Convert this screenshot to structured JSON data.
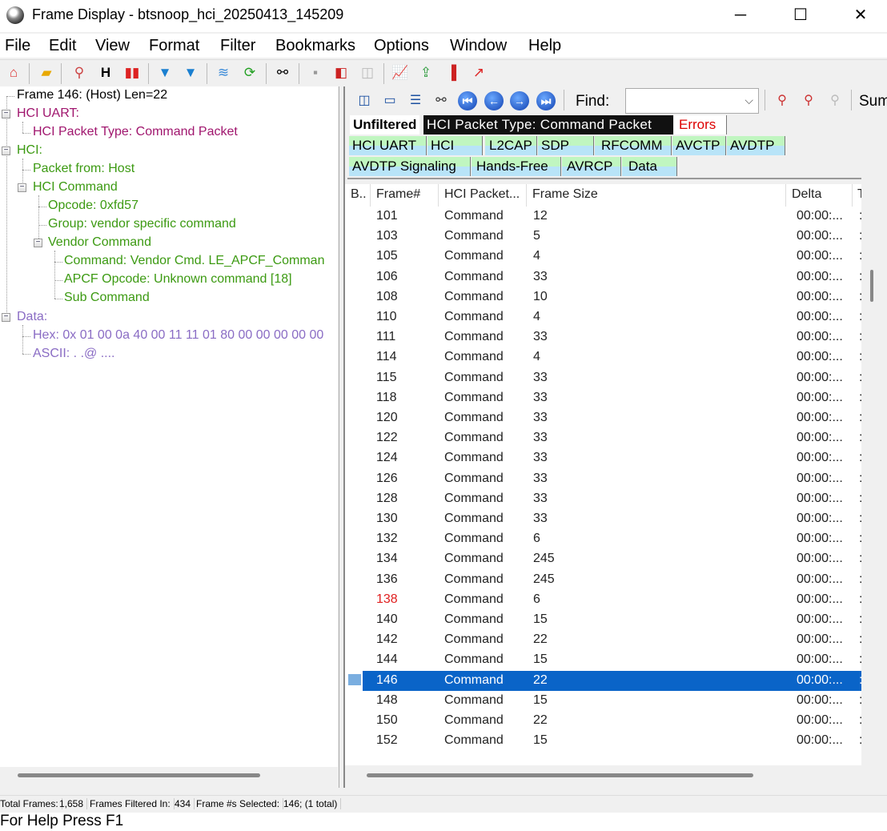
{
  "window": {
    "title": "Frame Display - btsnoop_hci_20250413_145209",
    "minimize": "─",
    "maximize": "☐",
    "close": "✕"
  },
  "menu": [
    "File",
    "Edit",
    "View",
    "Format",
    "Filter",
    "Bookmarks",
    "Options",
    "Window",
    "Help"
  ],
  "toolbar_icons": [
    "home-icon",
    "open-folder-icon",
    "magnifier-icon",
    "hex-icon",
    "decode-icon",
    "filter-icon",
    "filter-apply-icon",
    "layers-icon",
    "refresh-icon",
    "binoculars-icon",
    "note-icon",
    "bookmark-book-icon",
    "open-book-icon",
    "line-chart-icon",
    "export-icon",
    "bar-chart-icon",
    "trend-chart-icon"
  ],
  "tree": {
    "frame": "Frame 146: (Host) Len=22",
    "uart": "HCI UART:",
    "packet_type": "HCI Packet Type: Command Packet",
    "hci": "HCI:",
    "packet_from": "Packet from: Host",
    "hci_command": "HCI Command",
    "opcode": "Opcode: 0xfd57",
    "group": "Group: vendor specific command",
    "vendor_command": "Vendor Command",
    "command": "Command: Vendor Cmd. LE_APCF_Comman",
    "apcf_opcode": "APCF Opcode: Unknown command [18]",
    "sub_command": "Sub Command",
    "data": "Data:",
    "hex": "Hex: 0x 01 00 0a 40 00 11 11 01 80 00 00 00 00 00",
    "ascii": "ASCII: . .@ ...."
  },
  "find": {
    "label": "Find:",
    "value": "",
    "summary": "Sum"
  },
  "tabs": {
    "unfiltered": "Unfiltered",
    "selected": "HCI Packet Type: Command Packet",
    "errors": "Errors",
    "row1": [
      "HCI UART",
      "HCI",
      "L2CAP",
      "SDP",
      "RFCOMM",
      "AVCTP",
      "AVDTP"
    ],
    "row2": [
      "AVDTP Signaling",
      "Hands-Free",
      "AVRCP",
      "Data"
    ]
  },
  "columns": [
    "B..",
    "Frame#",
    "HCI Packet...",
    "Frame Size",
    "Delta",
    "T"
  ],
  "rows": [
    {
      "frame": "101",
      "type": "Command",
      "size": "12",
      "delta": "00:00:..."
    },
    {
      "frame": "103",
      "type": "Command",
      "size": "5",
      "delta": "00:00:..."
    },
    {
      "frame": "105",
      "type": "Command",
      "size": "4",
      "delta": "00:00:..."
    },
    {
      "frame": "106",
      "type": "Command",
      "size": "33",
      "delta": "00:00:..."
    },
    {
      "frame": "108",
      "type": "Command",
      "size": "10",
      "delta": "00:00:..."
    },
    {
      "frame": "110",
      "type": "Command",
      "size": "4",
      "delta": "00:00:..."
    },
    {
      "frame": "111",
      "type": "Command",
      "size": "33",
      "delta": "00:00:..."
    },
    {
      "frame": "114",
      "type": "Command",
      "size": "4",
      "delta": "00:00:..."
    },
    {
      "frame": "115",
      "type": "Command",
      "size": "33",
      "delta": "00:00:..."
    },
    {
      "frame": "118",
      "type": "Command",
      "size": "33",
      "delta": "00:00:..."
    },
    {
      "frame": "120",
      "type": "Command",
      "size": "33",
      "delta": "00:00:..."
    },
    {
      "frame": "122",
      "type": "Command",
      "size": "33",
      "delta": "00:00:..."
    },
    {
      "frame": "124",
      "type": "Command",
      "size": "33",
      "delta": "00:00:..."
    },
    {
      "frame": "126",
      "type": "Command",
      "size": "33",
      "delta": "00:00:..."
    },
    {
      "frame": "128",
      "type": "Command",
      "size": "33",
      "delta": "00:00:..."
    },
    {
      "frame": "130",
      "type": "Command",
      "size": "33",
      "delta": "00:00:..."
    },
    {
      "frame": "132",
      "type": "Command",
      "size": "6",
      "delta": "00:00:..."
    },
    {
      "frame": "134",
      "type": "Command",
      "size": "245",
      "delta": "00:00:..."
    },
    {
      "frame": "136",
      "type": "Command",
      "size": "245",
      "delta": "00:00:..."
    },
    {
      "frame": "138",
      "type": "Command",
      "size": "6",
      "delta": "00:00:...",
      "error": true
    },
    {
      "frame": "140",
      "type": "Command",
      "size": "15",
      "delta": "00:00:..."
    },
    {
      "frame": "142",
      "type": "Command",
      "size": "22",
      "delta": "00:00:..."
    },
    {
      "frame": "144",
      "type": "Command",
      "size": "15",
      "delta": "00:00:..."
    },
    {
      "frame": "146",
      "type": "Command",
      "size": "22",
      "delta": "00:00:...",
      "selected": true
    },
    {
      "frame": "148",
      "type": "Command",
      "size": "15",
      "delta": "00:00:..."
    },
    {
      "frame": "150",
      "type": "Command",
      "size": "22",
      "delta": "00:00:..."
    },
    {
      "frame": "152",
      "type": "Command",
      "size": "15",
      "delta": "00:00:..."
    }
  ],
  "status": {
    "total_label": "Total Frames:",
    "total": "1,658",
    "filtered_label": "Frames Filtered In:",
    "filtered": "434",
    "selected_label": "Frame #s Selected:",
    "selected": "146; (1 total)",
    "help": "For Help Press F1"
  },
  "colors": {
    "uart": "#a0166e",
    "hci": "#3c9a12",
    "data": "#8a6cc4",
    "selected_row": "#0a64c8",
    "error": "#e02020"
  }
}
